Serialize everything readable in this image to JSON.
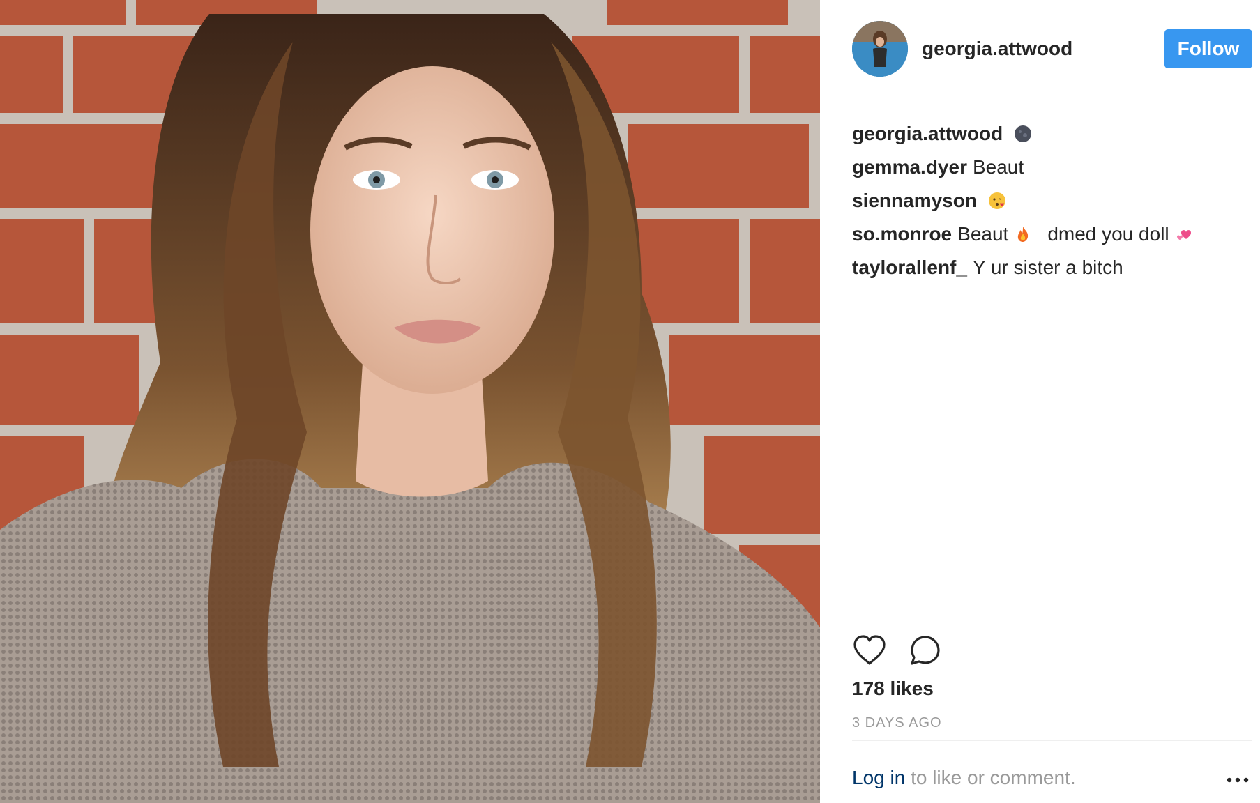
{
  "post": {
    "photo_alt": "selfie photo",
    "author": {
      "username": "georgia.attwood",
      "follow_label": "Follow"
    },
    "comments": [
      {
        "author": "georgia.attwood",
        "text": "",
        "emoji": "dark-moon-emoji"
      },
      {
        "author": "gemma.dyer",
        "text": "Beaut",
        "emoji": ""
      },
      {
        "author": "siennamyson",
        "text": "",
        "emoji": "kissing-face-emoji"
      },
      {
        "author": "so.monroe",
        "text": "Beaut",
        "emoji": "fire-emoji",
        "text2": "dmed you doll",
        "emoji2": "two-hearts-emoji"
      },
      {
        "author": "taylorallenf_",
        "text": "Y ur sister a bitch",
        "emoji": ""
      }
    ],
    "actions": {
      "like_icon": "heart-icon",
      "comment_icon": "comment-bubble-icon"
    },
    "likes": "178 likes",
    "timestamp": "3 DAYS AGO",
    "login_prompt": {
      "link": "Log in",
      "rest": " to like or comment."
    },
    "more_icon": "more-options-icon",
    "colors": {
      "follow_button": "#3897f0",
      "link": "#003569",
      "muted": "#999999",
      "text": "#262626"
    }
  }
}
